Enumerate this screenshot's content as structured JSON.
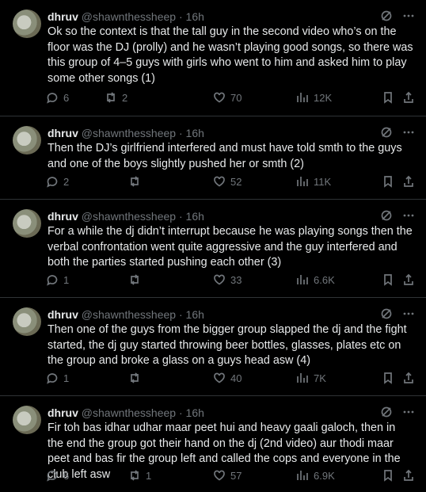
{
  "author": {
    "name": "dhruv",
    "handle": "@shawnthessheep",
    "time": "16h"
  },
  "tweets": [
    {
      "text": "Ok so the context is that the tall guy in the second video who’s on the floor was the DJ (prolly) and he wasn’t playing good songs, so there was this group of 4–5 guys with girls who went to him and asked him to play some other songs (1)",
      "replies": "6",
      "retweets": "2",
      "likes": "70",
      "views": "12K"
    },
    {
      "text": "Then the DJ’s girlfriend interfered and must have told smth to the guys and one of the boys slightly pushed her or smth (2)",
      "replies": "2",
      "retweets": "",
      "likes": "52",
      "views": "11K"
    },
    {
      "text": "For a while the dj didn’t interrupt because he was playing songs then the verbal confrontation went quite aggressive and the guy interfered and both the parties started pushing each other (3)",
      "replies": "1",
      "retweets": "",
      "likes": "33",
      "views": "6.6K"
    },
    {
      "text": "Then one of the guys from the bigger group slapped the dj and the fight started, the dj guy started throwing beer bottles, glasses, plates etc on the group and broke a glass on a guys head asw (4)",
      "replies": "1",
      "retweets": "",
      "likes": "40",
      "views": "7K"
    },
    {
      "text": "Fir toh bas idhar udhar maar peet hui and heavy gaali galoch, then in the end the group got their hand on the dj (2nd video) aur thodi maar peet and bas fir the group left and called the cops and everyone in the club left asw",
      "replies": "6",
      "retweets": "1",
      "likes": "57",
      "views": "6.9K"
    }
  ]
}
